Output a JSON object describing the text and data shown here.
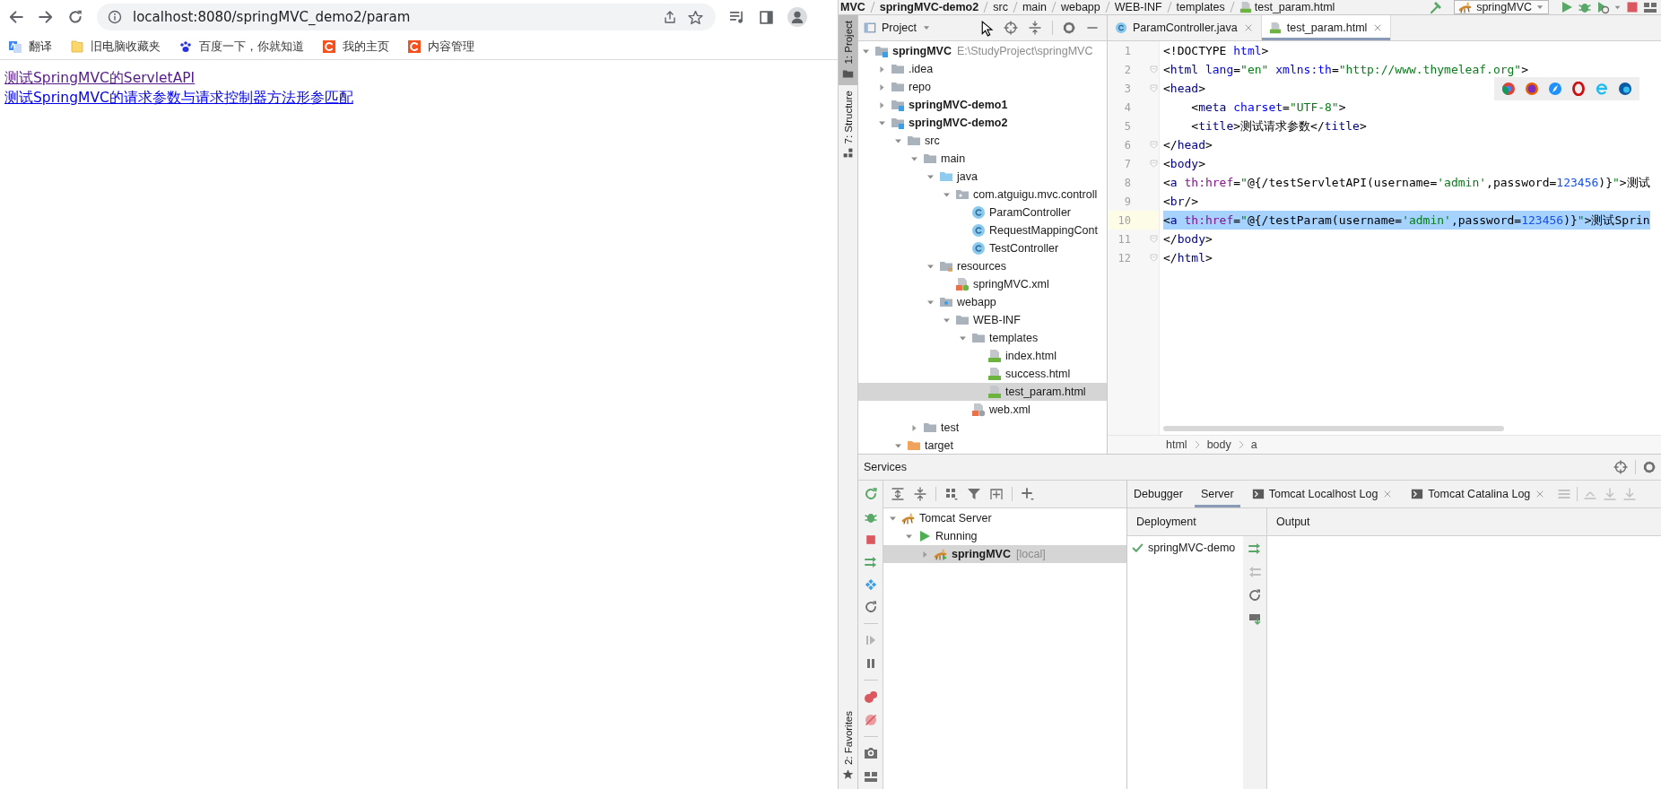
{
  "browser": {
    "url": "localhost:8080/springMVC_demo2/param",
    "bookmarks": [
      {
        "label": "翻译",
        "kind": "translate"
      },
      {
        "label": "旧电脑收藏夹",
        "kind": "bm-folder"
      },
      {
        "label": "百度一下，你就知道",
        "kind": "paw"
      },
      {
        "label": "我的主页",
        "kind": "c-logo"
      },
      {
        "label": "内容管理",
        "kind": "c-logo"
      }
    ],
    "links": [
      {
        "text": "测试SpringMVC的ServletAPI",
        "visited": true
      },
      {
        "text": "测试SpringMVC的请求参数与请求控制器方法形参匹配",
        "visited": false
      }
    ]
  },
  "ide": {
    "navbar": {
      "crumbs": [
        {
          "label": "MVC",
          "kind": "module"
        },
        {
          "label": "springMVC-demo2",
          "kind": "module"
        },
        {
          "label": "src",
          "kind": "folder"
        },
        {
          "label": "main",
          "kind": "folder"
        },
        {
          "label": "webapp",
          "kind": "folder"
        },
        {
          "label": "WEB-INF",
          "kind": "folder"
        },
        {
          "label": "templates",
          "kind": "folder"
        },
        {
          "label": "test_param.html",
          "kind": "html"
        }
      ],
      "run_config": "springMVC"
    },
    "tool_windows": {
      "left": [
        {
          "label": "1: Project",
          "kind": "project",
          "selected": true
        },
        {
          "label": "7: Structure",
          "kind": "structure",
          "selected": false
        }
      ],
      "bottom": [
        {
          "label": "2: Favorites",
          "kind": "favorites",
          "selected": false
        }
      ]
    },
    "project": {
      "title": "Project",
      "tree": [
        {
          "label": "springMVC",
          "path": "E:\\StudyProject\\springMVC",
          "kind": "module",
          "expanded": true,
          "selected": false,
          "children": [
            {
              "label": ".idea",
              "kind": "folder",
              "expanded": false,
              "selected": false
            },
            {
              "label": "repo",
              "kind": "folder",
              "expanded": false,
              "selected": false
            },
            {
              "label": "springMVC-demo1",
              "kind": "module",
              "expanded": false,
              "selected": false
            },
            {
              "label": "springMVC-demo2",
              "kind": "module",
              "expanded": true,
              "selected": false,
              "children": [
                {
                  "label": "src",
                  "kind": "folder",
                  "expanded": true,
                  "selected": false,
                  "children": [
                    {
                      "label": "main",
                      "kind": "folder",
                      "expanded": true,
                      "selected": false,
                      "children": [
                        {
                          "label": "java",
                          "kind": "source-folder",
                          "expanded": true,
                          "selected": false,
                          "children": [
                            {
                              "label": "com.atguigu.mvc.controll",
                              "kind": "package",
                              "expanded": true,
                              "selected": false,
                              "children": [
                                {
                                  "label": "ParamController",
                                  "kind": "class",
                                  "selected": false
                                },
                                {
                                  "label": "RequestMappingCont",
                                  "kind": "class",
                                  "selected": false
                                },
                                {
                                  "label": "TestController",
                                  "kind": "class",
                                  "selected": false
                                }
                              ]
                            }
                          ]
                        },
                        {
                          "label": "resources",
                          "kind": "resources",
                          "expanded": true,
                          "selected": false,
                          "children": [
                            {
                              "label": "springMVC.xml",
                              "kind": "spring-xml",
                              "selected": false
                            }
                          ]
                        },
                        {
                          "label": "webapp",
                          "kind": "web-folder",
                          "expanded": true,
                          "selected": false,
                          "children": [
                            {
                              "label": "WEB-INF",
                              "kind": "folder",
                              "expanded": true,
                              "selected": false,
                              "children": [
                                {
                                  "label": "templates",
                                  "kind": "folder",
                                  "expanded": true,
                                  "selected": false,
                                  "children": [
                                    {
                                      "label": "index.html",
                                      "kind": "html",
                                      "selected": false
                                    },
                                    {
                                      "label": "success.html",
                                      "kind": "html",
                                      "selected": false
                                    },
                                    {
                                      "label": "test_param.html",
                                      "kind": "html",
                                      "selected": true
                                    }
                                  ]
                                },
                                {
                                  "label": "web.xml",
                                  "kind": "web-xml",
                                  "selected": false
                                }
                              ]
                            }
                          ]
                        }
                      ]
                    },
                    {
                      "label": "test",
                      "kind": "folder",
                      "expanded": false,
                      "selected": false
                    }
                  ]
                },
                {
                  "label": "target",
                  "kind": "excluded-folder",
                  "expanded": true,
                  "selected": false
                }
              ]
            }
          ]
        }
      ]
    },
    "editor": {
      "tabs": [
        {
          "label": "ParamController.java",
          "kind": "class",
          "selected": false
        },
        {
          "label": "test_param.html",
          "kind": "html",
          "selected": true
        }
      ],
      "lines": [
        {
          "number": "1",
          "fold": false,
          "selected": false,
          "tokens": [
            {
              "text": "<!DOCTYPE ",
              "kind": "plain"
            },
            {
              "text": "html",
              "kind": "attr"
            },
            {
              "text": ">",
              "kind": "plain"
            }
          ]
        },
        {
          "number": "2",
          "fold": true,
          "selected": false,
          "tokens": [
            {
              "text": "<",
              "kind": "plain"
            },
            {
              "text": "html",
              "kind": "tag"
            },
            {
              "text": " lang",
              "kind": "attr"
            },
            {
              "text": "=",
              "kind": "plain"
            },
            {
              "text": "\"en\"",
              "kind": "value"
            },
            {
              "text": " xmlns:th",
              "kind": "attr"
            },
            {
              "text": "=",
              "kind": "plain"
            },
            {
              "text": "\"http://www.thymeleaf.org\"",
              "kind": "value"
            },
            {
              "text": ">",
              "kind": "plain"
            }
          ]
        },
        {
          "number": "3",
          "fold": true,
          "selected": false,
          "tokens": [
            {
              "text": "<",
              "kind": "plain"
            },
            {
              "text": "head",
              "kind": "tag"
            },
            {
              "text": ">",
              "kind": "plain"
            }
          ]
        },
        {
          "number": "4",
          "fold": false,
          "selected": false,
          "tokens": [
            {
              "text": "    <",
              "kind": "plain"
            },
            {
              "text": "meta",
              "kind": "tag"
            },
            {
              "text": " charset",
              "kind": "attr"
            },
            {
              "text": "=",
              "kind": "plain"
            },
            {
              "text": "\"UTF-8\"",
              "kind": "value"
            },
            {
              "text": ">",
              "kind": "plain"
            }
          ]
        },
        {
          "number": "5",
          "fold": false,
          "selected": false,
          "tokens": [
            {
              "text": "    <",
              "kind": "plain"
            },
            {
              "text": "title",
              "kind": "tag"
            },
            {
              "text": ">测试请求参数</",
              "kind": "plain"
            },
            {
              "text": "title",
              "kind": "tag"
            },
            {
              "text": ">",
              "kind": "plain"
            }
          ]
        },
        {
          "number": "6",
          "fold": true,
          "selected": false,
          "tokens": [
            {
              "text": "</",
              "kind": "plain"
            },
            {
              "text": "head",
              "kind": "tag"
            },
            {
              "text": ">",
              "kind": "plain"
            }
          ]
        },
        {
          "number": "7",
          "fold": true,
          "selected": false,
          "tokens": [
            {
              "text": "<",
              "kind": "plain"
            },
            {
              "text": "body",
              "kind": "tag"
            },
            {
              "text": ">",
              "kind": "plain"
            }
          ]
        },
        {
          "number": "8",
          "fold": false,
          "selected": false,
          "tokens": [
            {
              "text": "<",
              "kind": "plain"
            },
            {
              "text": "a",
              "kind": "tag"
            },
            {
              "text": " th:href",
              "kind": "ns"
            },
            {
              "text": "=",
              "kind": "plain"
            },
            {
              "text": "\"",
              "kind": "value"
            },
            {
              "text": "@{/testServletAPI(username=",
              "kind": "plain"
            },
            {
              "text": "'admin'",
              "kind": "value"
            },
            {
              "text": ",password=",
              "kind": "plain"
            },
            {
              "text": "123456",
              "kind": "number"
            },
            {
              "text": ")}",
              "kind": "plain"
            },
            {
              "text": "\"",
              "kind": "value"
            },
            {
              "text": ">测试",
              "kind": "plain"
            }
          ]
        },
        {
          "number": "9",
          "fold": false,
          "selected": false,
          "tokens": [
            {
              "text": "<",
              "kind": "plain"
            },
            {
              "text": "br",
              "kind": "tag"
            },
            {
              "text": "/>",
              "kind": "plain"
            }
          ]
        },
        {
          "number": "10",
          "fold": false,
          "selected": true,
          "tokens": [
            {
              "text": "<",
              "kind": "plain"
            },
            {
              "text": "a",
              "kind": "tag"
            },
            {
              "text": " th:href",
              "kind": "ns"
            },
            {
              "text": "=",
              "kind": "plain"
            },
            {
              "text": "\"",
              "kind": "value"
            },
            {
              "text": "@{/testParam(username=",
              "kind": "plain"
            },
            {
              "text": "'admin'",
              "kind": "value"
            },
            {
              "text": ",password=",
              "kind": "plain"
            },
            {
              "text": "123456",
              "kind": "number"
            },
            {
              "text": ")}",
              "kind": "plain"
            },
            {
              "text": "\"",
              "kind": "value"
            },
            {
              "text": ">测试Sprin",
              "kind": "plain"
            }
          ]
        },
        {
          "number": "11",
          "fold": true,
          "selected": false,
          "tokens": [
            {
              "text": "</",
              "kind": "plain"
            },
            {
              "text": "body",
              "kind": "tag"
            },
            {
              "text": ">",
              "kind": "plain"
            }
          ]
        },
        {
          "number": "12",
          "fold": true,
          "selected": false,
          "tokens": [
            {
              "text": "</",
              "kind": "plain"
            },
            {
              "text": "html",
              "kind": "tag"
            },
            {
              "text": ">",
              "kind": "plain"
            }
          ]
        }
      ],
      "breadcrumb": [
        "html",
        "body",
        "a"
      ]
    },
    "services": {
      "title": "Services",
      "tree": [
        {
          "label": "Tomcat Server",
          "kind": "server",
          "expanded": true,
          "selected": false,
          "children": [
            {
              "label": "Running",
              "kind": "running",
              "expanded": true,
              "selected": false,
              "children": [
                {
                  "label": "springMVC",
                  "suffix": "[local]",
                  "kind": "app",
                  "expanded": false,
                  "selected": true
                }
              ]
            }
          ]
        }
      ],
      "tabs": [
        {
          "label": "Debugger",
          "kind": "plain",
          "selected": false
        },
        {
          "label": "Server",
          "kind": "plain",
          "selected": true
        },
        {
          "label": "Tomcat Localhost Log",
          "kind": "console",
          "selected": false
        },
        {
          "label": "Tomcat Catalina Log",
          "kind": "console",
          "selected": false
        }
      ],
      "columns": [
        "Deployment",
        "Output"
      ],
      "deployments": [
        {
          "label": "springMVC-demo"
        }
      ]
    }
  }
}
